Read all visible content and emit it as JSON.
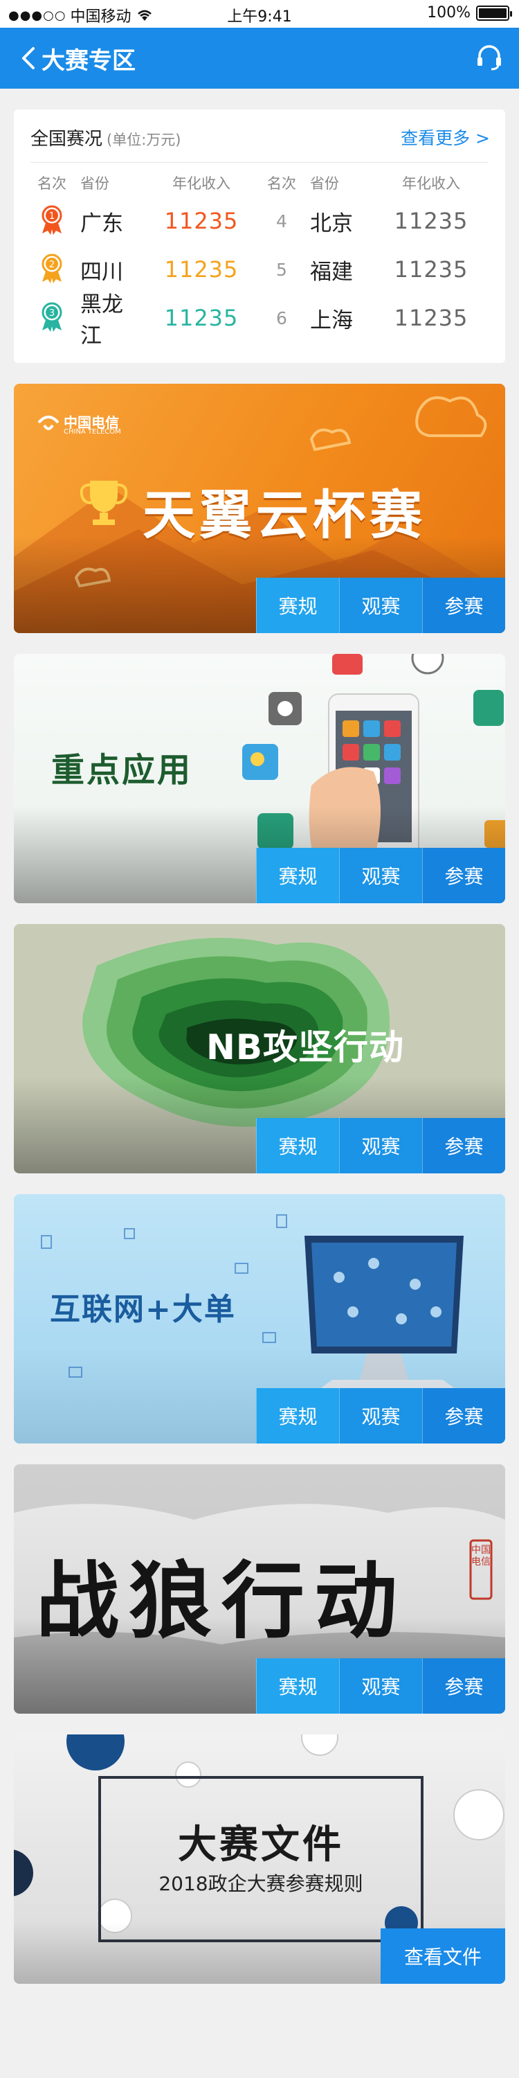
{
  "status_bar": {
    "carrier": "中国移动",
    "time": "上午9:41",
    "battery": "100%"
  },
  "header": {
    "title": "大赛专区",
    "back_icon": "chevron-left-icon",
    "service_icon": "headset-icon"
  },
  "ranking": {
    "title": "全国赛况",
    "unit": "(单位:万元)",
    "more": "查看更多 >",
    "columns": [
      "名次",
      "省份",
      "年化收入"
    ],
    "left": [
      {
        "rank": "1",
        "province": "广东",
        "value": "11235",
        "color": "#f2561d"
      },
      {
        "rank": "2",
        "province": "四川",
        "value": "11235",
        "color": "#f5a21c"
      },
      {
        "rank": "3",
        "province": "黑龙江",
        "value": "11235",
        "color": "#27b4a0"
      }
    ],
    "right": [
      {
        "rank": "4",
        "province": "北京",
        "value": "11235"
      },
      {
        "rank": "5",
        "province": "福建",
        "value": "11235"
      },
      {
        "rank": "6",
        "province": "上海",
        "value": "11235"
      }
    ]
  },
  "banner_buttons": [
    "赛规",
    "观赛",
    "参赛"
  ],
  "banners": [
    {
      "title": "天翼云杯赛",
      "logo": "中国电信",
      "logo_sub": "CHINA TELECOM"
    },
    {
      "title": "重点应用"
    },
    {
      "title": "NB攻坚行动"
    },
    {
      "title": "互联网+大单"
    },
    {
      "title": "战狼行动",
      "seal": "中国电信"
    }
  ],
  "doc_banner": {
    "title": "大赛文件",
    "subtitle": "2018政企大赛参赛规则",
    "button": "查看文件"
  },
  "colors": {
    "primary": "#1a8be8",
    "rank1": "#f2561d",
    "rank2": "#f5a21c",
    "rank3": "#27b4a0"
  }
}
